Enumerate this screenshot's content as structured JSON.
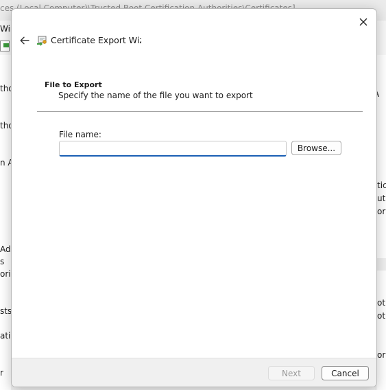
{
  "background": {
    "title_fragment": "ces (Local Computer)\\Trusted Root Certification Authorities\\Certificates]",
    "menu_fragment": "Win",
    "left_fragments": [
      "tho",
      "tho",
      "n A",
      "Adc",
      "s",
      "ori",
      "sts",
      "atic",
      "r"
    ],
    "right_fragments": [
      "A",
      "ticı",
      "uth",
      "orp",
      "ot",
      "ot",
      "ori"
    ]
  },
  "dialog": {
    "title": "Certificate Export Wizard",
    "section_title": "File to Export",
    "section_description": "Specify the name of the file you want to export",
    "file_name_label": "File name:",
    "file_name_value": "",
    "browse_label": "Browse...",
    "next_label": "Next",
    "cancel_label": "Cancel"
  },
  "icons": {
    "close": "close-icon",
    "back": "back-arrow-icon",
    "wizard": "certificate-icon"
  }
}
